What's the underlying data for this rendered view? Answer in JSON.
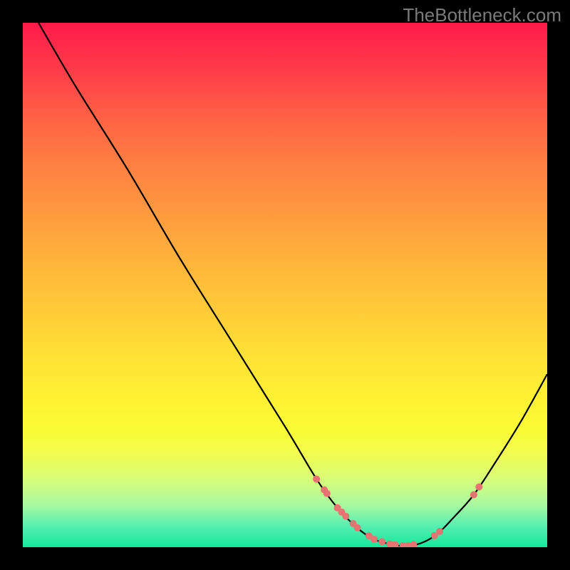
{
  "watermark": "TheBottleneck.com",
  "chart_data": {
    "type": "line",
    "title": "",
    "xlabel": "",
    "ylabel": "",
    "xlim": [
      0,
      100
    ],
    "ylim": [
      0,
      100
    ],
    "grid": false,
    "curve": {
      "comment": "Approximate bottleneck-percentage V-curve; x is normalized position across plot, y is normalized height (0 = bottom).",
      "x": [
        3,
        10,
        20,
        30,
        40,
        50,
        56,
        60,
        64,
        67,
        70,
        73,
        76,
        79,
        82,
        86,
        90,
        95,
        100
      ],
      "y": [
        100,
        88,
        72,
        55,
        39,
        23,
        13,
        7.5,
        3.5,
        1.5,
        0.6,
        0.2,
        0.8,
        2.5,
        5.5,
        10,
        16,
        24,
        33
      ]
    },
    "markers": {
      "comment": "Salmon sample dots on the curve",
      "x": [
        56.0,
        57.5,
        58.0,
        60.0,
        60.8,
        61.6,
        63.0,
        63.8,
        66.0,
        67.0,
        68.5,
        70.0,
        71.0,
        72.5,
        73.5,
        74.5,
        78.5,
        79.5,
        86.0,
        87.0
      ],
      "r": [
        5,
        5,
        5,
        5,
        5,
        5,
        5,
        5,
        5,
        5,
        5,
        5,
        5,
        5,
        5,
        5,
        5,
        5,
        5,
        5
      ]
    }
  }
}
